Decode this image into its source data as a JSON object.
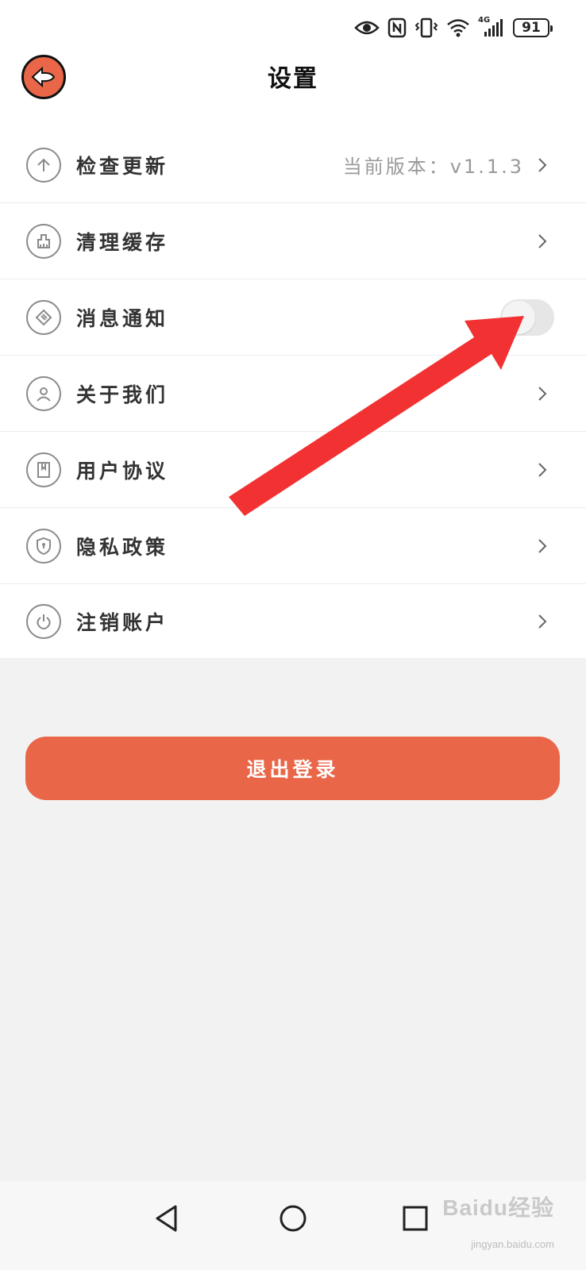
{
  "status_bar": {
    "network_label": "4G",
    "battery_level": "91",
    "icons": [
      "eye-icon",
      "nfc-icon",
      "vibrate-icon",
      "wifi-icon",
      "signal-icon",
      "battery-icon"
    ]
  },
  "header": {
    "title": "设置",
    "back_icon": "back-arrow-icon"
  },
  "settings": {
    "items": [
      {
        "label": "检查更新",
        "value": "当前版本：v1.1.3",
        "icon": "arrow-up-icon",
        "control": "chevron"
      },
      {
        "label": "清理缓存",
        "icon": "broom-icon",
        "control": "chevron"
      },
      {
        "label": "消息通知",
        "icon": "message-icon",
        "control": "toggle",
        "toggle_on": false
      },
      {
        "label": "关于我们",
        "icon": "user-icon",
        "control": "chevron"
      },
      {
        "label": "用户协议",
        "icon": "document-icon",
        "control": "chevron"
      },
      {
        "label": "隐私政策",
        "icon": "shield-icon",
        "control": "chevron"
      },
      {
        "label": "注销账户",
        "icon": "power-icon",
        "control": "chevron"
      }
    ]
  },
  "logout": {
    "label": "退出登录"
  },
  "colors": {
    "accent": "#ea6648",
    "arrow": "#f23232",
    "background": "#f2f2f2"
  },
  "watermark": {
    "brand": "Baidu经验",
    "url": "jingyan.baidu.com"
  },
  "nav_bar": {
    "icons": [
      "back-triangle-icon",
      "home-circle-icon",
      "recents-square-icon"
    ]
  }
}
